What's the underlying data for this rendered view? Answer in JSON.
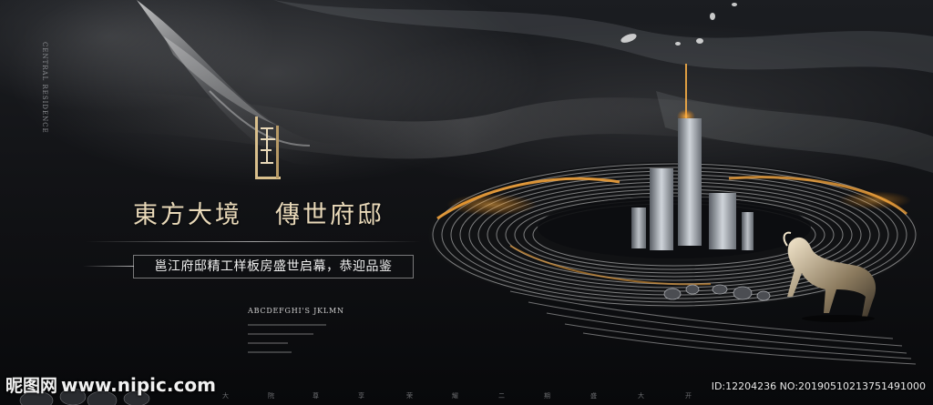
{
  "vertical_text": "CENTRAL RESIDENCE",
  "headline": {
    "left": "東方大境",
    "right": "傳世府邸"
  },
  "subtitle": "邕江府邸精工样板房盛世启幕，恭迎品鉴",
  "abc_line": "ABCDEFGHI'S JKLMN",
  "bottom_chars": [
    "大",
    "院",
    "尊",
    "享",
    "荣",
    "耀",
    "二",
    "期",
    "盛",
    "大",
    "开"
  ],
  "watermark": {
    "brand": "昵图网",
    "url": "www.nipic.com",
    "id": "ID:12204236 NO:20190510213751491000"
  },
  "colors": {
    "gold": "#e9d9b9",
    "accent_orange": "#f0a13a",
    "background": "#0b0c0e"
  },
  "icons": [
    "logo-emblem-icon",
    "skyline-graphic",
    "horse-statue-graphic",
    "petals-graphic"
  ]
}
